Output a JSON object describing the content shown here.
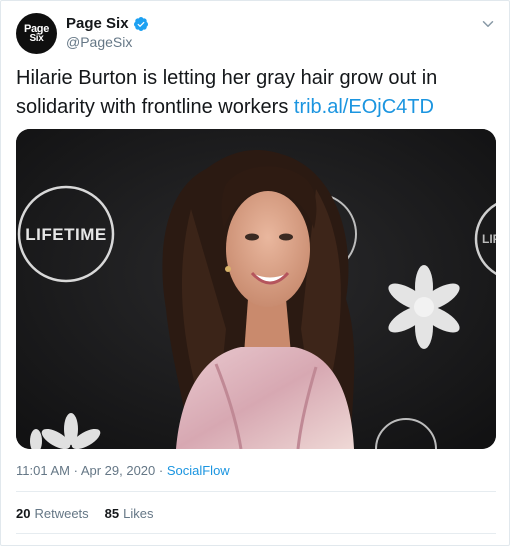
{
  "account": {
    "avatar_line1": "Page",
    "avatar_line2": "Six",
    "name": "Page Six",
    "handle": "@PageSix"
  },
  "tweet": {
    "text": "Hilarie Burton is letting her gray hair grow out in solidarity with frontline workers",
    "link": "trib.al/EOjC4TD"
  },
  "media": {
    "backdrop_text_left": "LIFETIME",
    "backdrop_text_right": "LIF"
  },
  "meta": {
    "time": "11:01 AM",
    "separator1": " · ",
    "date": "Apr 29, 2020",
    "separator2": " · ",
    "source": "SocialFlow"
  },
  "stats": {
    "retweets_count": "20",
    "retweets_label": "Retweets",
    "likes_count": "85",
    "likes_label": "Likes"
  },
  "colors": {
    "link_blue": "#1b95e0",
    "verified_blue": "#1da1f2",
    "secondary_text": "#657786"
  }
}
